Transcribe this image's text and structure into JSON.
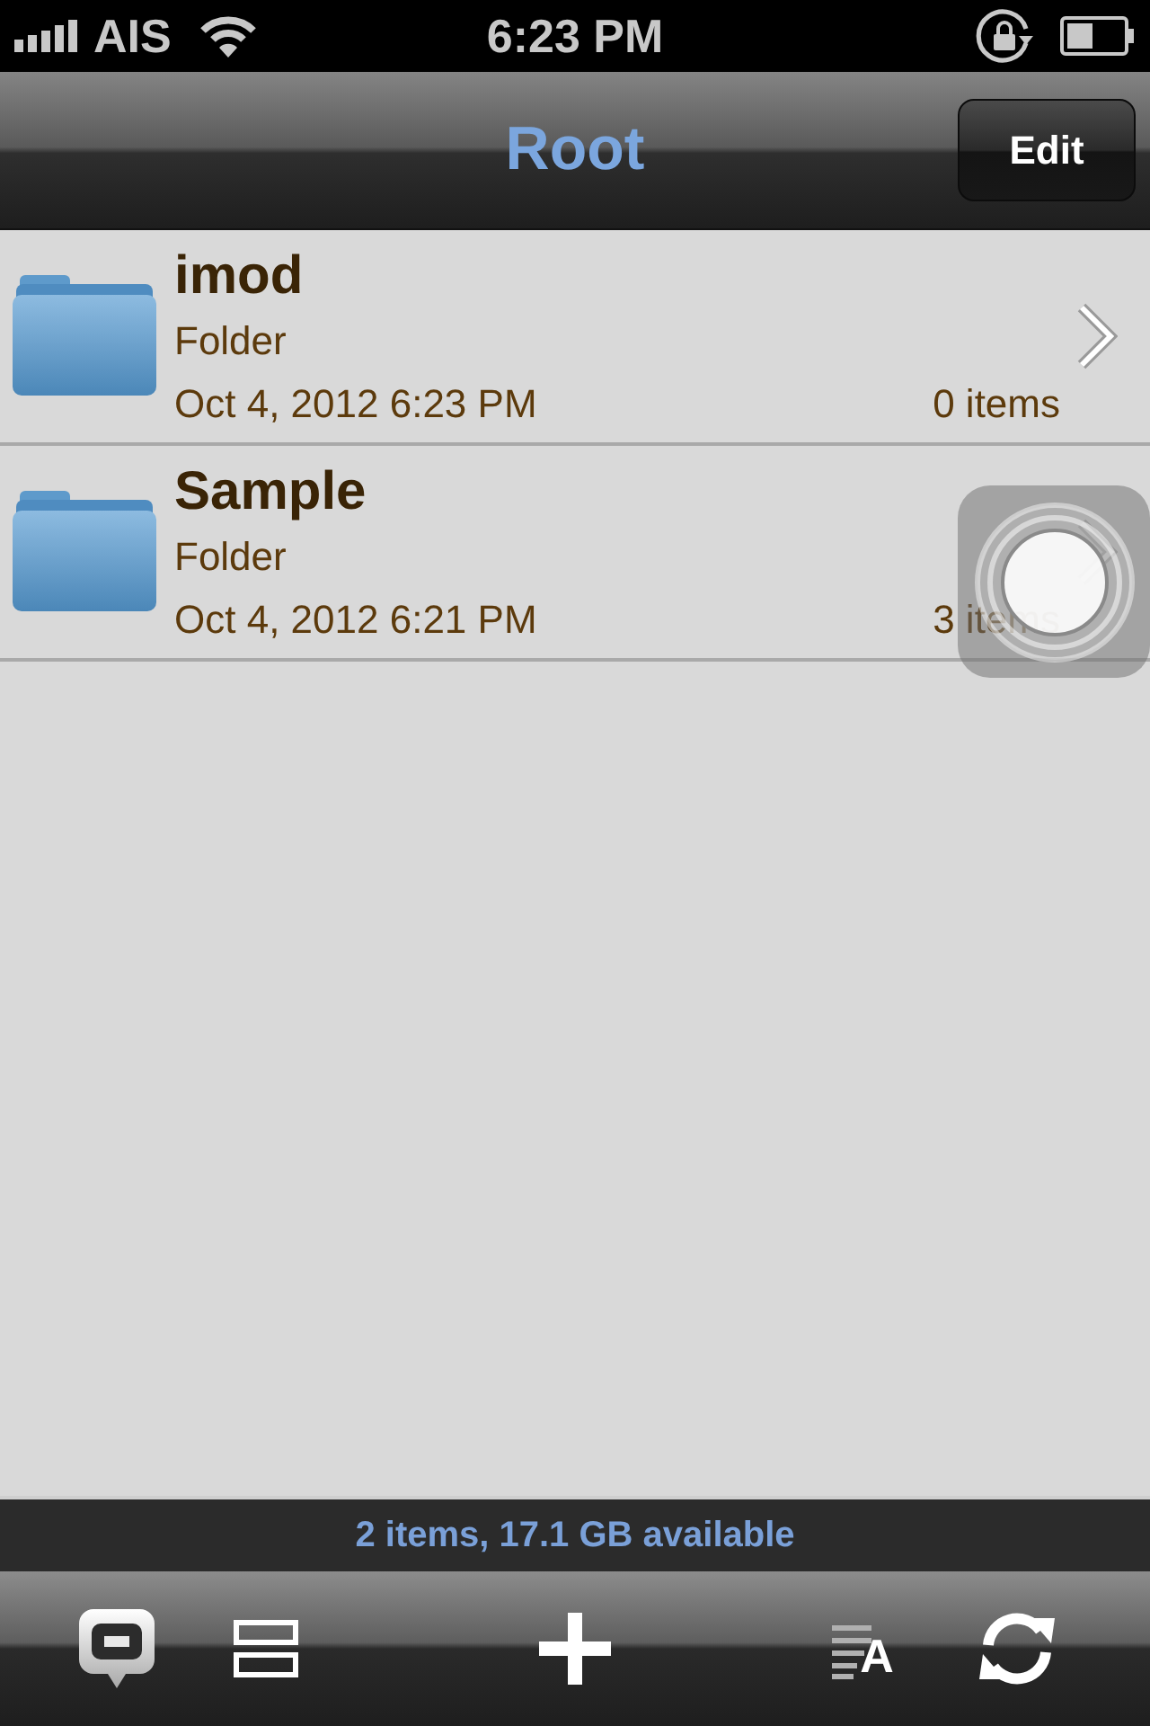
{
  "status_bar": {
    "carrier": "AIS",
    "time": "6:23 PM"
  },
  "nav_bar": {
    "title": "Root",
    "edit_button": "Edit"
  },
  "items": [
    {
      "name": "imod",
      "type": "Folder",
      "modified": "Oct 4, 2012 6:23 PM",
      "contents": "0 items"
    },
    {
      "name": "Sample",
      "type": "Folder",
      "modified": "Oct 4, 2012 6:21 PM",
      "contents": "3 items"
    }
  ],
  "summary": "2 items, 17.1 GB available",
  "toolbar": {
    "sort_glyph": "A"
  }
}
